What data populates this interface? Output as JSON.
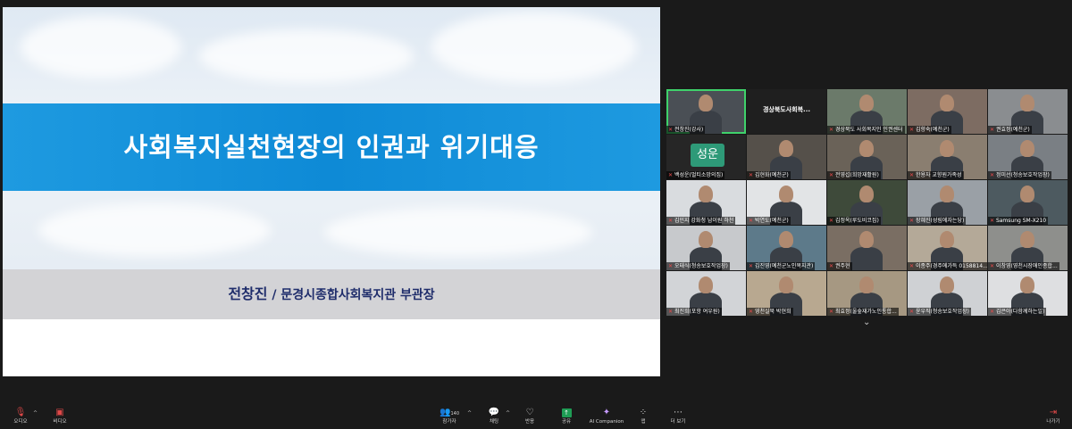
{
  "slide": {
    "title": "사회복지실천현장의 인권과 위기대응",
    "presenter_name": "전창진",
    "presenter_separator": "/",
    "presenter_affiliation": "문경시종합사회복지관 부관장"
  },
  "gallery": {
    "tiles": [
      {
        "label": "전창진(강사)",
        "type": "video",
        "active": true
      },
      {
        "label": "",
        "type": "text",
        "center_text": "경상북도사회복..."
      },
      {
        "label": "경상북도 사회복지인 인권센터",
        "type": "video"
      },
      {
        "label": "김향숙(예천군)",
        "type": "video"
      },
      {
        "label": "권효정(예천군)",
        "type": "video"
      },
      {
        "label": "백성운(멀티소망의집)",
        "type": "avatar",
        "avatar_text": "성운"
      },
      {
        "label": "김현화(예천군)",
        "type": "video"
      },
      {
        "label": "전영섭(희망재활원)",
        "type": "video"
      },
      {
        "label": "한용자 교향원가족성",
        "type": "video"
      },
      {
        "label": "정미선(청송보호작업장)",
        "type": "video"
      },
      {
        "label": "김민지 강화청 남이원 하천",
        "type": "video"
      },
      {
        "label": "박연도(예천군)",
        "type": "video"
      },
      {
        "label": "김정옥(루도비코집)",
        "type": "video"
      },
      {
        "label": "장혜진(성림에자는당)",
        "type": "video"
      },
      {
        "label": "Samsung SM-X210",
        "type": "video"
      },
      {
        "label": "오태식(청송보호작업장)",
        "type": "video"
      },
      {
        "label": "김진영(예천군노인복지관)",
        "type": "video"
      },
      {
        "label": "권주현",
        "type": "video"
      },
      {
        "label": "이종주(경주에가득 0158814...",
        "type": "video"
      },
      {
        "label": "이창영(영천시장애인종합...",
        "type": "video"
      },
      {
        "label": "최진희(포항 여우원)",
        "type": "video"
      },
      {
        "label": "영천실북 박현희",
        "type": "video"
      },
      {
        "label": "최효정(울숲재가노인통합...",
        "type": "video"
      },
      {
        "label": "윤우직(청송보호작업장)",
        "type": "video"
      },
      {
        "label": "김은아(다함께하는일)",
        "type": "video"
      }
    ],
    "more_icon": "chevron-down-icon"
  },
  "toolbar": {
    "audio_label": "오디오",
    "video_label": "비디오",
    "participants_label": "참가자",
    "participants_count": "140",
    "chat_label": "채팅",
    "react_label": "반응",
    "share_label": "공유",
    "ai_label": "AI Companion",
    "apps_label": "앱",
    "more_label": "더 보기",
    "leave_label": "나가기"
  },
  "colors": {
    "title_band": "#0e8ad6",
    "presenter_text": "#1f2d6b",
    "active_speaker": "#3fd26b",
    "share_green": "#1f9d55",
    "mute_red": "#e04848"
  }
}
